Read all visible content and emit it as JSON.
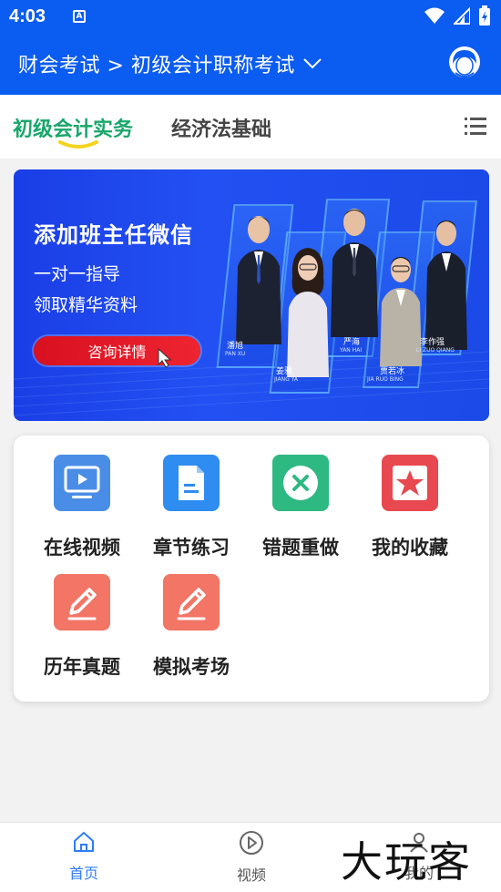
{
  "status_bar": {
    "time": "4:03",
    "notif_letter": "A"
  },
  "header": {
    "breadcrumb": "财会考试 > 初级会计职称考试"
  },
  "tabs": [
    {
      "label": "初级会计实务",
      "active": true
    },
    {
      "label": "经济法基础",
      "active": false
    }
  ],
  "banner": {
    "title": "添加班主任微信",
    "line1": "一对一指导",
    "line2": "领取精华资料",
    "button": "咨询详情",
    "teachers": [
      {
        "name": "潘旭",
        "en": "PAN XU"
      },
      {
        "name": "姜雅",
        "en": "JIANG YA"
      },
      {
        "name": "严海",
        "en": "YAN HAI"
      },
      {
        "name": "贾若冰",
        "en": "JIA RUO BING"
      },
      {
        "name": "李作强",
        "en": "LI ZUO QIANG"
      }
    ]
  },
  "features": [
    {
      "label": "在线视频",
      "icon": "video-icon",
      "color": "#4a8de6"
    },
    {
      "label": "章节练习",
      "icon": "document-icon",
      "color": "#2f8cf0"
    },
    {
      "label": "错题重做",
      "icon": "error-redo-icon",
      "color": "#2eb882"
    },
    {
      "label": "我的收藏",
      "icon": "star-icon",
      "color": "#e8484f"
    },
    {
      "label": "历年真题",
      "icon": "pencil-icon",
      "color": "#f27565"
    },
    {
      "label": "模拟考场",
      "icon": "pencil-icon",
      "color": "#f27565"
    }
  ],
  "bottom_nav": [
    {
      "label": "首页",
      "icon": "home-icon",
      "active": true
    },
    {
      "label": "视频",
      "icon": "play-icon",
      "active": false
    },
    {
      "label": "我的",
      "icon": "profile-icon",
      "active": false
    }
  ],
  "watermark": "大玩客",
  "colors": {
    "primary": "#0b5cf0",
    "accent_green": "#1aa66b",
    "underline_yellow": "#f5d21c"
  }
}
